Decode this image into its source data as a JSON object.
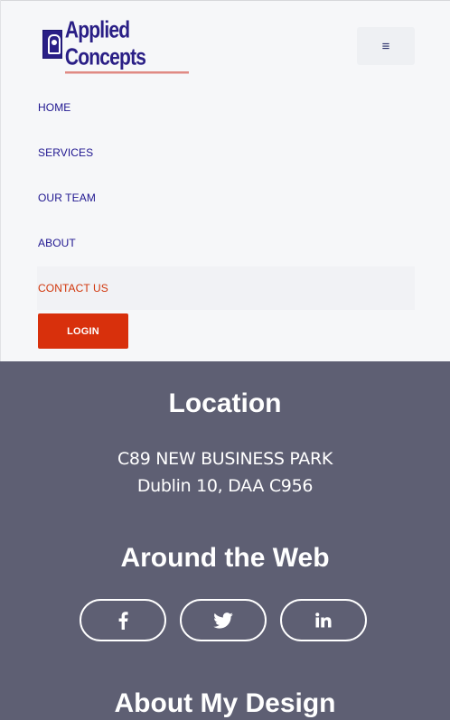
{
  "brand": {
    "name": "Applied Concepts"
  },
  "header": {
    "menu_icon": "hamburger-icon"
  },
  "nav": {
    "items": [
      {
        "label": "HOME",
        "active": false
      },
      {
        "label": "SERVICES",
        "active": false
      },
      {
        "label": "OUR TEAM",
        "active": false
      },
      {
        "label": "ABOUT",
        "active": false
      },
      {
        "label": "CONTACT US",
        "active": true
      }
    ],
    "login_label": "LOGIN"
  },
  "footer": {
    "location_title": "Location",
    "address_line1": "C89 NEW BUSINESS PARK",
    "address_line2": "Dublin 10, DAA C956",
    "web_title": "Around the Web",
    "socials": [
      {
        "icon": "facebook-icon"
      },
      {
        "icon": "twitter-icon"
      },
      {
        "icon": "linkedin-icon"
      }
    ],
    "about_title": "About My Design"
  },
  "colors": {
    "brand_blue": "#2a1f86",
    "accent_red": "#d8300c",
    "footer_bg": "#5e5f73",
    "header_bg": "#f6f7f9"
  }
}
